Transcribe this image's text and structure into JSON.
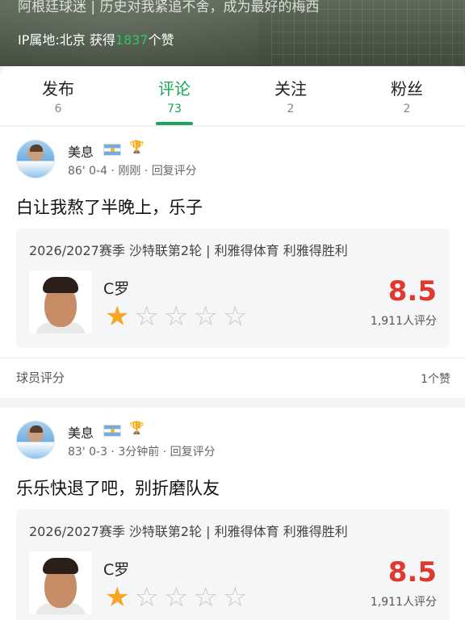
{
  "profile": {
    "bio": "阿根廷球迷 | 历史对我紧追不舍，成为最好的梅西",
    "ip_prefix": "IP属地:北京 获得",
    "likes": "1837",
    "likes_suffix": "个赞"
  },
  "tabs": [
    {
      "label": "发布",
      "count": "6"
    },
    {
      "label": "评论",
      "count": "73"
    },
    {
      "label": "关注",
      "count": "2"
    },
    {
      "label": "粉丝",
      "count": "2"
    }
  ],
  "comments": [
    {
      "user": "美息",
      "meta": "86' 0-4 · 刚刚 · ",
      "reply": "回复评分",
      "text": "白让我熬了半晚上，乐子",
      "match": "2026/2027赛季 沙特联第2轮 | 利雅得体育 利雅得胜利",
      "player": "C罗",
      "score": "8.5",
      "raters": "1,911人评分",
      "rating": 1,
      "footer_label": "球员评分",
      "footer_likes": "1个赞"
    },
    {
      "user": "美息",
      "meta": "83' 0-3 · 3分钟前 · ",
      "reply": "回复评分",
      "text": "乐乐快退了吧，别折磨队友",
      "match": "2026/2027赛季 沙特联第2轮 | 利雅得体育 利雅得胜利",
      "player": "C罗",
      "score": "8.5",
      "raters": "1,911人评分",
      "rating": 1
    }
  ],
  "colors": {
    "accent": "#1aa55a",
    "score": "#e03a2f",
    "star_on": "#f5a623",
    "star_off": "#c9c9c9"
  },
  "icons": {
    "flag": "argentina-flag-icon",
    "trophy": "trophy-icon",
    "star": "star-icon"
  }
}
